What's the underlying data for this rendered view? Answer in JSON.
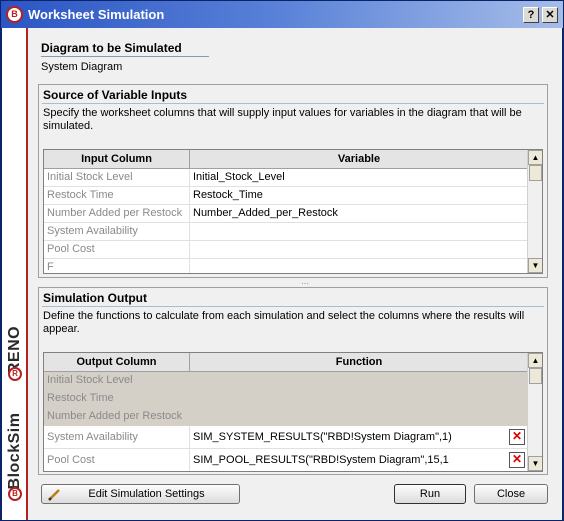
{
  "window": {
    "title": "Worksheet Simulation",
    "help_label": "?",
    "close_label": "✕",
    "logo_letter": "B"
  },
  "sidebar": {
    "product": "BlockSim",
    "company": "RENO",
    "logo_letter": "B",
    "r_letter": "R",
    "accent_color": "#b52020"
  },
  "diagram": {
    "heading": "Diagram to be Simulated",
    "value": "System Diagram"
  },
  "inputs": {
    "heading": "Source of Variable Inputs",
    "description": "Specify the worksheet columns that will supply input values for variables in the diagram that will be simulated.",
    "columns": [
      "Input Column",
      "Variable"
    ],
    "rows": [
      {
        "input": "Initial Stock Level",
        "variable": "Initial_Stock_Level"
      },
      {
        "input": "Restock Time",
        "variable": "Restock_Time"
      },
      {
        "input": "Number Added per Restock",
        "variable": "Number_Added_per_Restock"
      },
      {
        "input": "System Availability",
        "variable": ""
      },
      {
        "input": "Pool Cost",
        "variable": ""
      },
      {
        "input": "F",
        "variable": ""
      }
    ]
  },
  "output": {
    "heading": "Simulation Output",
    "description": "Define the functions to calculate from each simulation and select the columns where the results will appear.",
    "columns": [
      "Output Column",
      "Function"
    ],
    "rows": [
      {
        "output": "Initial Stock Level",
        "function": ""
      },
      {
        "output": "Restock Time",
        "function": ""
      },
      {
        "output": "Number Added per Restock",
        "function": ""
      },
      {
        "output": "System Availability",
        "function": "SIM_SYSTEM_RESULTS(\"RBD!System  Diagram\",1)"
      },
      {
        "output": "Pool Cost",
        "function": "SIM_POOL_RESULTS(\"RBD!System Diagram\",15,1"
      }
    ],
    "delete_glyph": "✕"
  },
  "footer": {
    "edit_label": "Edit Simulation Settings",
    "run_label": "Run",
    "close_label": "Close"
  }
}
